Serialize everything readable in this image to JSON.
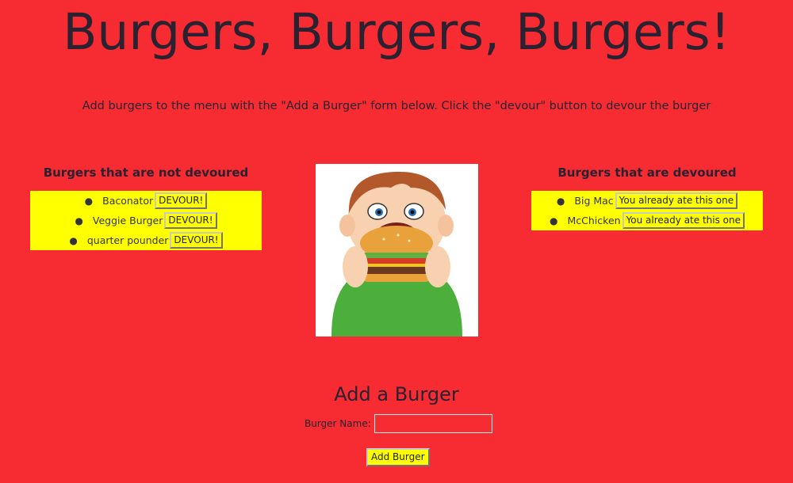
{
  "header": {
    "title": "Burgers, Burgers, Burgers!",
    "subtitle": "Add burgers to the menu with the \"Add a Burger\" form below. Click the \"devour\" button to devour the burger"
  },
  "not_devoured": {
    "heading": "Burgers that are not devoured",
    "items": [
      {
        "name": "Baconator",
        "button": "DEVOUR!"
      },
      {
        "name": "Veggie Burger",
        "button": "DEVOUR!"
      },
      {
        "name": "quarter pounder",
        "button": "DEVOUR!"
      }
    ]
  },
  "devoured": {
    "heading": "Burgers that are devoured",
    "items": [
      {
        "name": "Big Mac",
        "button": "You already ate this one"
      },
      {
        "name": "McChicken",
        "button": "You already ate this one"
      }
    ]
  },
  "image": {
    "icon": "boy-eating-burger-illustration"
  },
  "form": {
    "title": "Add a Burger",
    "label": "Burger Name:",
    "input_value": "",
    "submit_label": "Add Burger"
  },
  "colors": {
    "background": "#f72b32",
    "panel": "#ffff00"
  }
}
